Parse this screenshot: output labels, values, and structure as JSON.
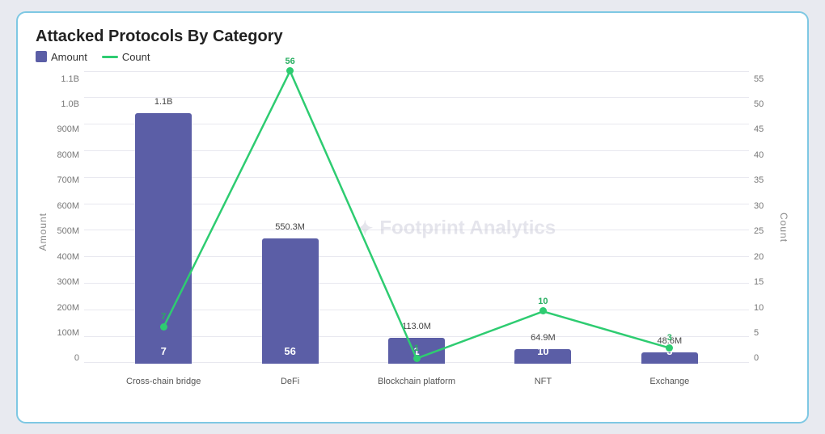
{
  "title": "Attacked Protocols By Category",
  "legend": {
    "amount_label": "Amount",
    "count_label": "Count",
    "amount_color": "#5b5ea6",
    "count_color": "#2ecc71"
  },
  "y_axis_left": {
    "label": "Amount",
    "ticks": [
      "1.1B",
      "1.0B",
      "900M",
      "800M",
      "700M",
      "600M",
      "500M",
      "400M",
      "300M",
      "200M",
      "100M",
      "0"
    ]
  },
  "y_axis_right": {
    "label": "Count",
    "ticks": [
      "55",
      "50",
      "45",
      "40",
      "35",
      "30",
      "25",
      "20",
      "15",
      "10",
      "5",
      "0"
    ]
  },
  "watermark": "Footprint Analytics",
  "bars": [
    {
      "category": "Cross-chain bridge",
      "amount": "1.1B",
      "amount_val": 1100,
      "count": 7,
      "count_val": 7
    },
    {
      "category": "DeFi",
      "amount": "550.3M",
      "amount_val": 550,
      "count": 56,
      "count_val": 56
    },
    {
      "category": "Blockchain platform",
      "amount": "113.0M",
      "amount_val": 113,
      "count": 1,
      "count_val": 1
    },
    {
      "category": "NFT",
      "amount": "64.9M",
      "amount_val": 65,
      "count": 10,
      "count_val": 10
    },
    {
      "category": "Exchange",
      "amount": "48.6M",
      "amount_val": 49,
      "count": 3,
      "count_val": 3
    }
  ]
}
